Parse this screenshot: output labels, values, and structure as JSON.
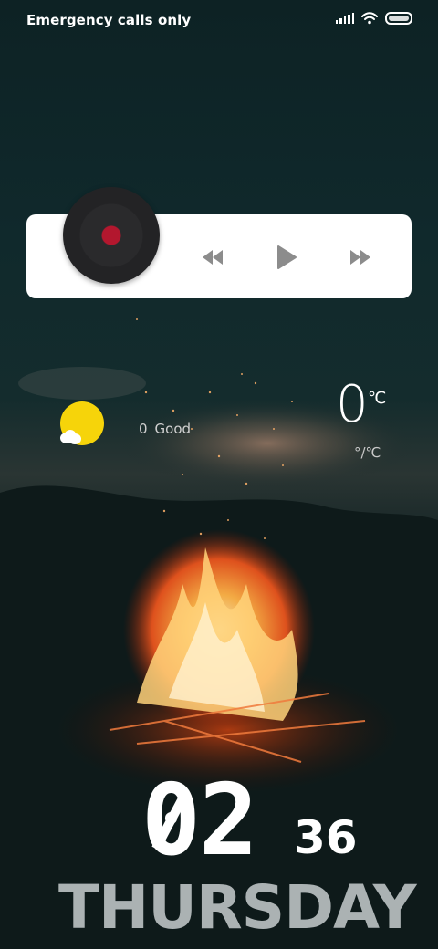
{
  "status_bar": {
    "carrier_text": "Emergency calls only",
    "icons": [
      "signal-icon",
      "wifi-icon",
      "battery-icon"
    ]
  },
  "music_widget": {
    "icons": [
      "vinyl-record-icon",
      "previous-track-icon",
      "play-icon",
      "next-track-icon"
    ],
    "vinyl_center_color": "#b3172e"
  },
  "weather": {
    "icon": "sun-cloud-icon",
    "aqi_value": "0",
    "aqi_label": "Good",
    "temperature": "0",
    "temperature_unit": "℃",
    "temperature_range": "°/℃"
  },
  "clock": {
    "hour": "02",
    "minute": "36",
    "day": "THURSDAY"
  },
  "colors": {
    "sun": "#f6d40a",
    "controls": "#8c8c8c",
    "card": "#ffffff"
  }
}
